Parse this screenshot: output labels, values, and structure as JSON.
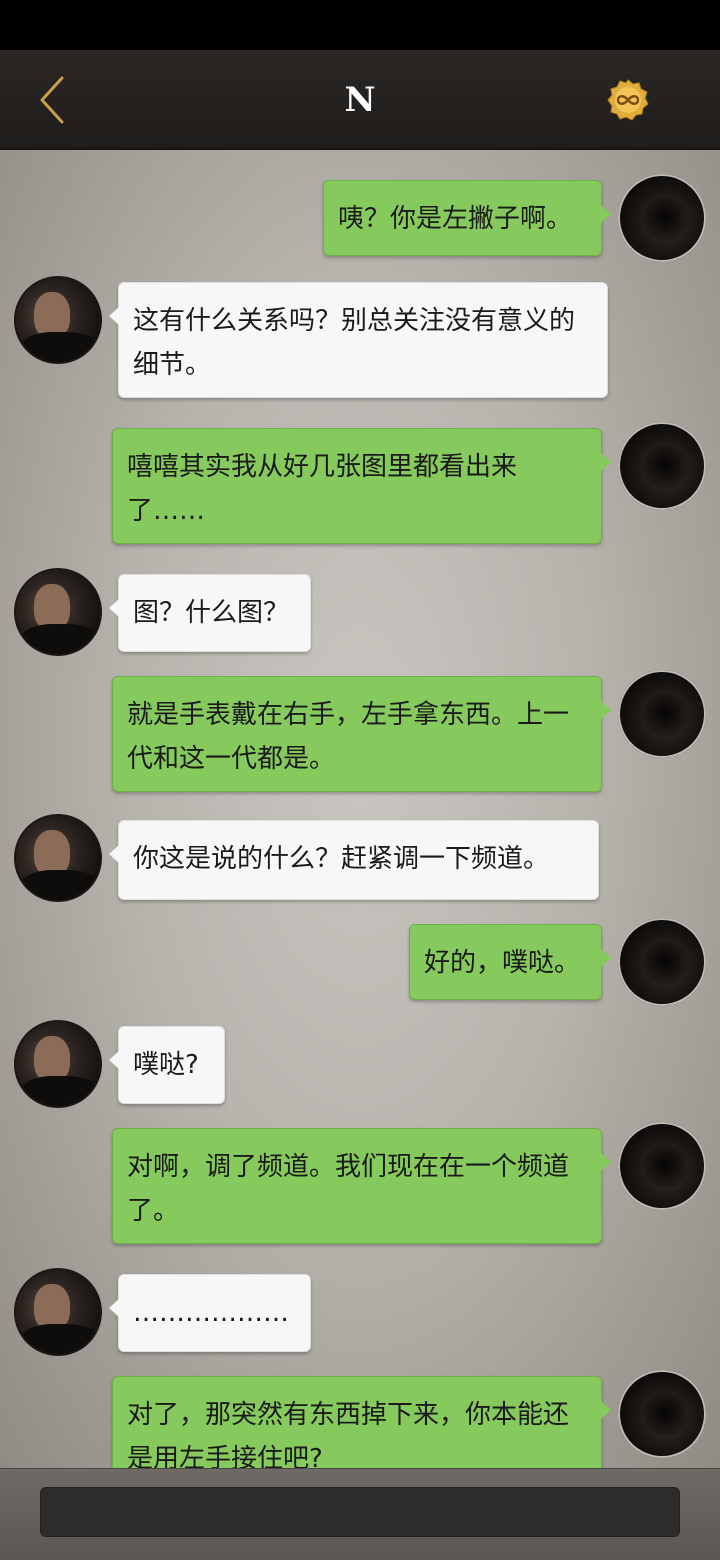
{
  "header": {
    "title": "N",
    "back_icon": "chevron-left-icon",
    "badge_icon": "infinity-badge-icon",
    "accent_color": "#c9a04a"
  },
  "messages": [
    {
      "sender": "me",
      "text": "咦？你是左撇子啊。"
    },
    {
      "sender": "other",
      "text": "这有什么关系吗？别总关注没有意义的细节。"
    },
    {
      "sender": "me",
      "text": "嘻嘻其实我从好几张图里都看出来了……"
    },
    {
      "sender": "other",
      "text": "图？什么图？"
    },
    {
      "sender": "me",
      "text": "就是手表戴在右手，左手拿东西。上一代和这一代都是。"
    },
    {
      "sender": "other",
      "text": "你这是说的什么？赶紧调一下频道。"
    },
    {
      "sender": "me",
      "text": "好的，噗哒。"
    },
    {
      "sender": "other",
      "text": "噗哒?"
    },
    {
      "sender": "me",
      "text": "对啊，调了频道。我们现在在一个频道了。"
    },
    {
      "sender": "other",
      "text": "………………"
    },
    {
      "sender": "me",
      "text": "对了，那突然有东西掉下来，你本能还是用左手接住吧?"
    }
  ],
  "input": {
    "value": ""
  },
  "colors": {
    "my_bubble": "#86c95d",
    "other_bubble": "#f7f7f7"
  }
}
